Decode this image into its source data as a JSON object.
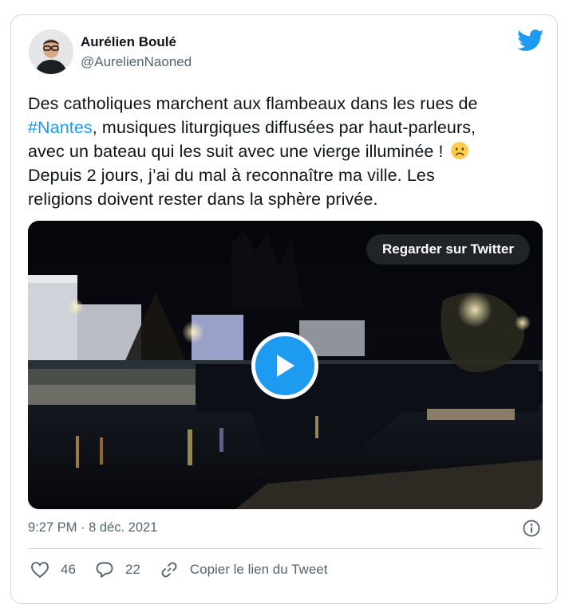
{
  "tweet": {
    "author_name": "Aurélien Boulé",
    "author_handle": "@AurelienNaoned",
    "text_lines": [
      "Des catholiques marchent aux flambeaux dans les rues de",
      "#Nantes",
      ", musiques liturgiques diffusées par haut-parleurs,",
      "avec un bateau qui les suit avec une vierge illuminée !",
      "Depuis 2 jours, j’ai du mal à reconnaître ma ville. Les",
      "religions doivent rester dans la sphère privée."
    ],
    "emoji": "frowning-face-emoji",
    "timestamp": "9:27 PM · 8 déc. 2021",
    "media": {
      "watch_label": "Regarder sur Twitter",
      "type": "video"
    },
    "actions": {
      "like_count": "46",
      "reply_count": "22",
      "copy_link_label": "Copier le lien du Tweet"
    }
  },
  "icons": {
    "brand": "twitter-bird-icon",
    "info": "info-icon",
    "like": "heart-icon",
    "reply": "speech-bubble-icon",
    "link": "link-icon",
    "play": "play-icon"
  },
  "colors": {
    "accent": "#1d9bf0",
    "text": "#0f1419",
    "muted": "#536471",
    "border": "#cfd9de"
  }
}
